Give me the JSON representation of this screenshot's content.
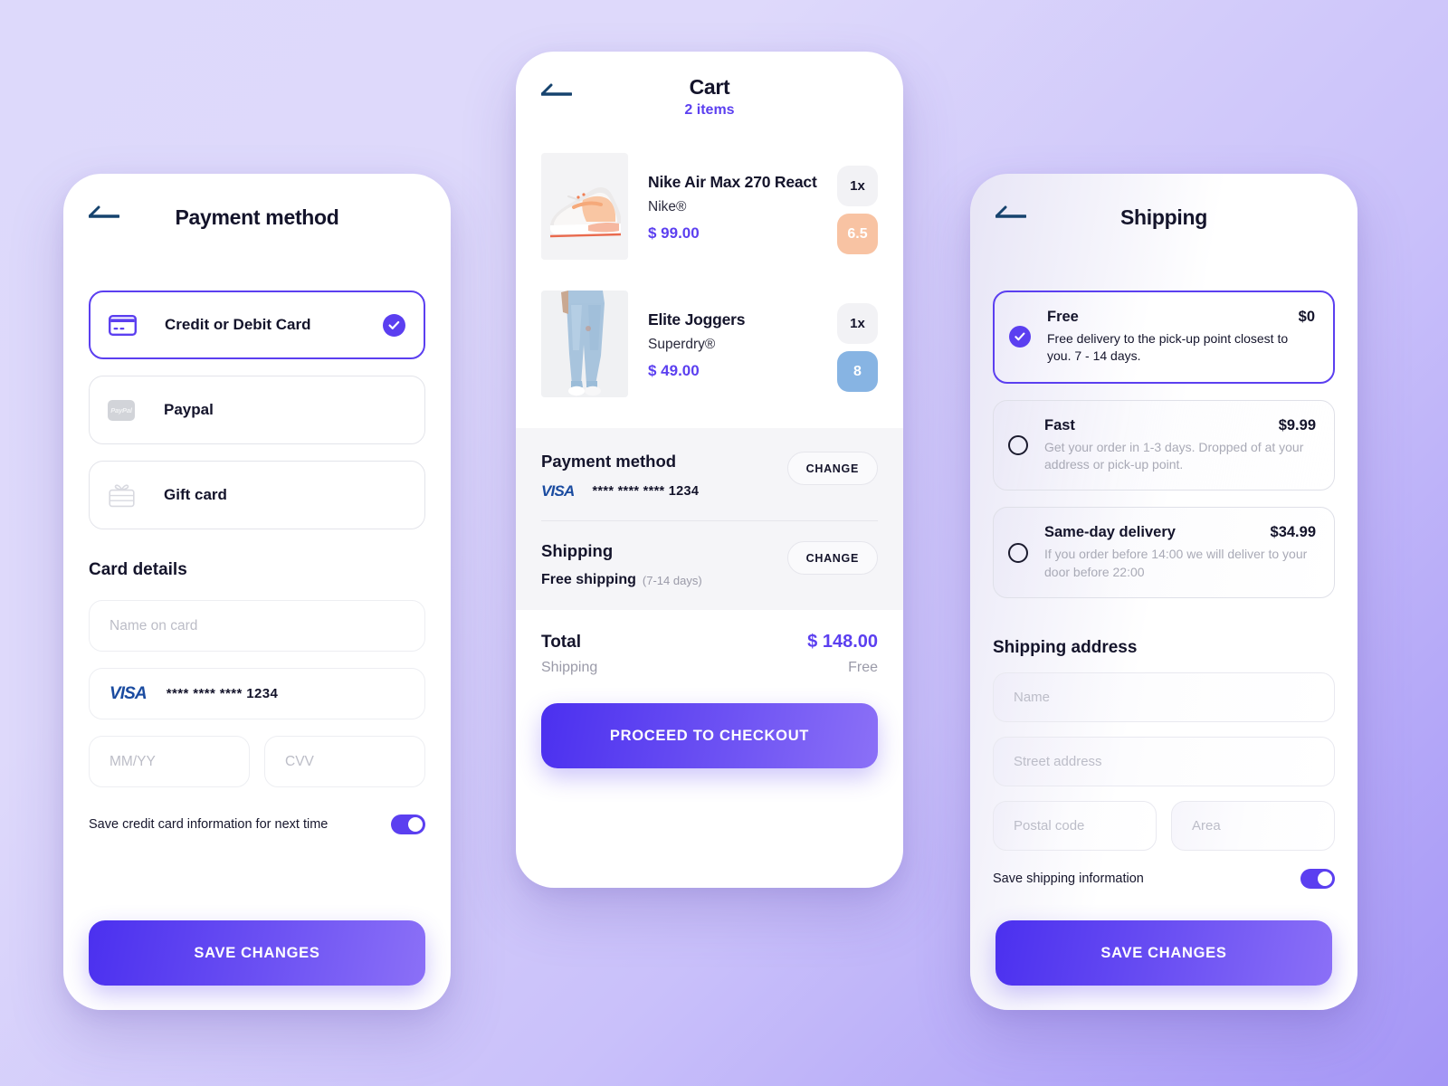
{
  "theme": {
    "accent": "#5b3ff0",
    "accent_gradient_start": "#4b30ef",
    "accent_gradient_end": "#8b70f7",
    "background_start": "#ddd9fb",
    "background_end": "#a495f6",
    "text_dark": "#14142b",
    "text_muted": "#9a9aa8",
    "visa_blue": "#1a4ba0"
  },
  "payment_screen": {
    "back_icon": "back-arrow-icon",
    "title": "Payment method",
    "methods": [
      {
        "label": "Credit or Debit Card",
        "icon": "credit-card-icon",
        "selected": true
      },
      {
        "label": "Paypal",
        "icon": "paypal-logo-icon",
        "selected": false
      },
      {
        "label": "Gift card",
        "icon": "gift-card-icon",
        "selected": false
      }
    ],
    "card_details_title": "Card details",
    "name_placeholder": "Name on card",
    "saved_card": {
      "brand": "VISA",
      "number": "**** **** **** 1234"
    },
    "expiry_placeholder": "MM/YY",
    "cvv_placeholder": "CVV",
    "save_toggle_label": "Save credit card information for next time",
    "save_toggle_on": true,
    "cta_label": "SAVE CHANGES"
  },
  "cart_screen": {
    "back_icon": "back-arrow-icon",
    "title": "Cart",
    "subtitle": "2 items",
    "items": [
      {
        "name": "Nike Air Max 270 React",
        "brand": "Nike®",
        "price": "$ 99.00",
        "quantity": "1x",
        "size": "6.5",
        "size_color": "#f8c3a3",
        "thumb": "sneaker-thumbnail"
      },
      {
        "name": "Elite Joggers",
        "brand": "Superdry®",
        "price": "$ 49.00",
        "quantity": "1x",
        "size": "8",
        "size_color": "#87b4e3",
        "thumb": "joggers-thumbnail"
      }
    ],
    "payment": {
      "heading": "Payment method",
      "brand": "VISA",
      "number": "**** **** **** 1234",
      "change_label": "CHANGE"
    },
    "shipping": {
      "heading": "Shipping",
      "value": "Free shipping",
      "note": "(7-14 days)",
      "change_label": "CHANGE"
    },
    "totals": {
      "total_label": "Total",
      "total_value": "$ 148.00",
      "shipping_label": "Shipping",
      "shipping_value": "Free"
    },
    "cta_label": "PROCEED TO CHECKOUT"
  },
  "shipping_screen": {
    "back_icon": "back-arrow-icon",
    "title": "Shipping",
    "options": [
      {
        "name": "Free",
        "price": "$0",
        "desc": "Free delivery to the pick-up point closest to you. 7 - 14 days.",
        "selected": true
      },
      {
        "name": "Fast",
        "price": "$9.99",
        "desc": "Get your order in 1-3 days. Dropped of at your address or pick-up point.",
        "selected": false
      },
      {
        "name": "Same-day delivery",
        "price": "$34.99",
        "desc": "If you order before 14:00 we will deliver to your door before 22:00",
        "selected": false
      }
    ],
    "address_title": "Shipping address",
    "name_placeholder": "Name",
    "street_placeholder": "Street address",
    "postal_placeholder": "Postal code",
    "area_placeholder": "Area",
    "save_toggle_label": "Save shipping information",
    "save_toggle_on": true,
    "cta_label": "SAVE CHANGES"
  }
}
